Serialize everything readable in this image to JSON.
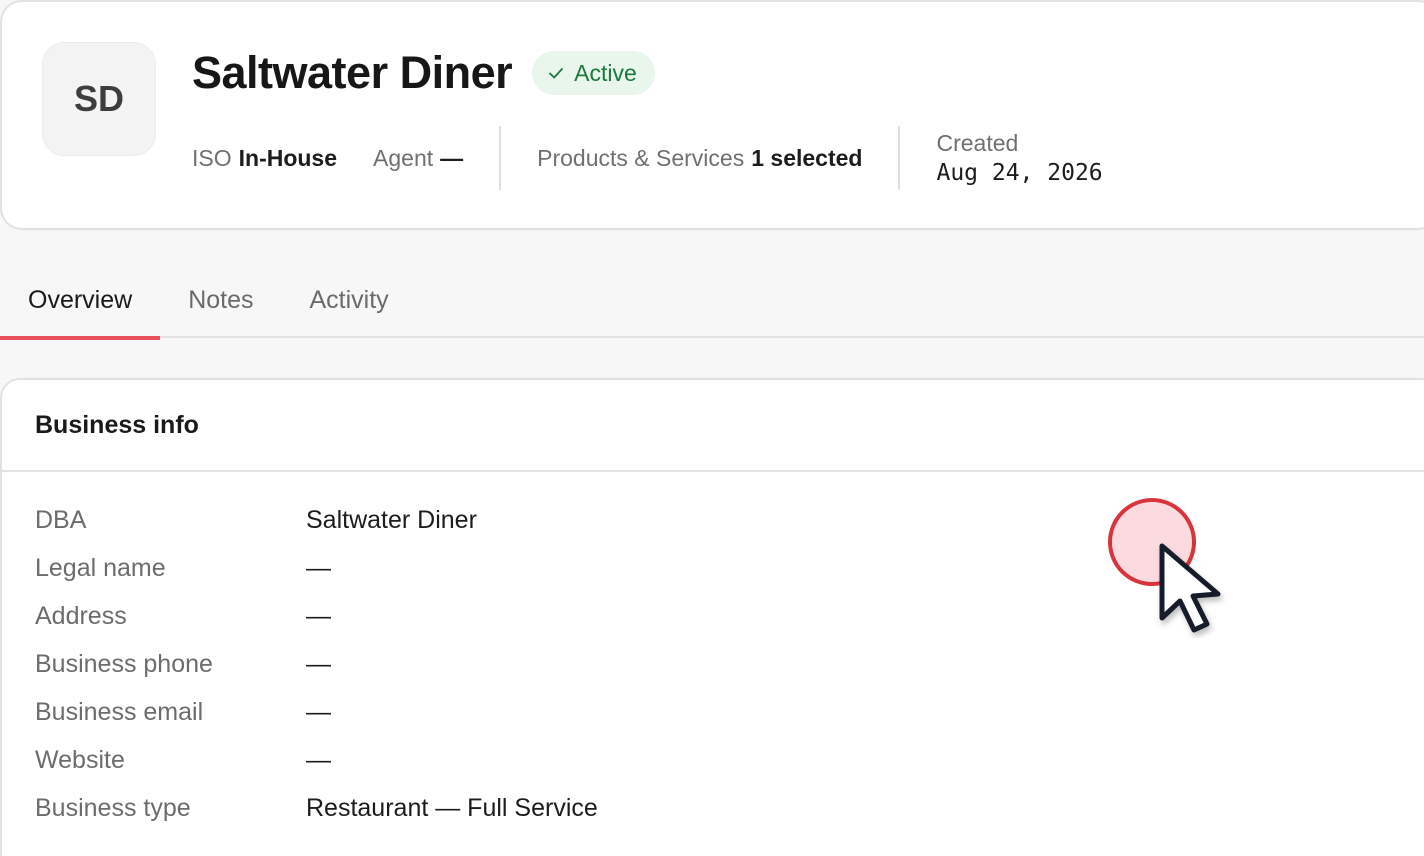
{
  "merchant": {
    "initials": "SD",
    "name": "Saltwater Diner",
    "status": "Active",
    "meta": {
      "iso_label": "ISO",
      "iso_value": "In-House",
      "agent_label": "Agent",
      "agent_value": "—",
      "products_label": "Products & Services",
      "products_value": "1 selected",
      "created_label": "Created",
      "created_value": "Aug 24, 2026"
    }
  },
  "tabs": [
    {
      "label": "Overview",
      "active": true
    },
    {
      "label": "Notes",
      "active": false
    },
    {
      "label": "Activity",
      "active": false
    }
  ],
  "business_info": {
    "title": "Business info",
    "rows": [
      {
        "label": "DBA",
        "value": "Saltwater Diner"
      },
      {
        "label": "Legal name",
        "value": "—"
      },
      {
        "label": "Address",
        "value": "—"
      },
      {
        "label": "Business phone",
        "value": "—"
      },
      {
        "label": "Business email",
        "value": "—"
      },
      {
        "label": "Website",
        "value": "—"
      },
      {
        "label": "Business type",
        "value": "Restaurant — Full Service"
      }
    ]
  },
  "colors": {
    "accent": "#e8505b",
    "status_bg": "#e8f6ec",
    "status_text": "#1b7a3c"
  },
  "icons": [
    "check-icon",
    "cursor-arrow-icon"
  ]
}
